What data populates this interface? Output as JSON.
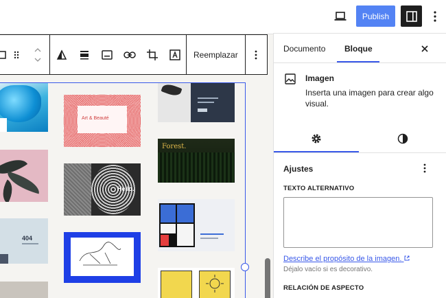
{
  "topbar": {
    "publish_label": "Publish",
    "device_icon": "laptop-icon",
    "sidebar_icon": "sidebar-icon",
    "more_icon": "more-vertical-icon"
  },
  "toolbar": {
    "replace_label": "Reemplazar"
  },
  "gallery": {
    "art_title": "Art & Beauté",
    "hello_title": "Hello.",
    "forest_title": "Forest.",
    "number_title": "404"
  },
  "panel": {
    "tabs": [
      {
        "label": "Documento"
      },
      {
        "label": "Bloque"
      }
    ],
    "block": {
      "name": "Imagen",
      "description": "Inserta una imagen para crear algo visual."
    },
    "settings": {
      "section_title": "Ajustes",
      "alt_label": "TEXTO ALTERNATIVO",
      "alt_value": "",
      "alt_link": "Describe el propósito de la imagen.",
      "alt_help": "Déjalo vacío si es decorativo.",
      "aspect_label": "RELACIÓN DE ASPECTO"
    }
  },
  "colors": {
    "accent": "#3858e9",
    "publish": "#5383f4"
  }
}
